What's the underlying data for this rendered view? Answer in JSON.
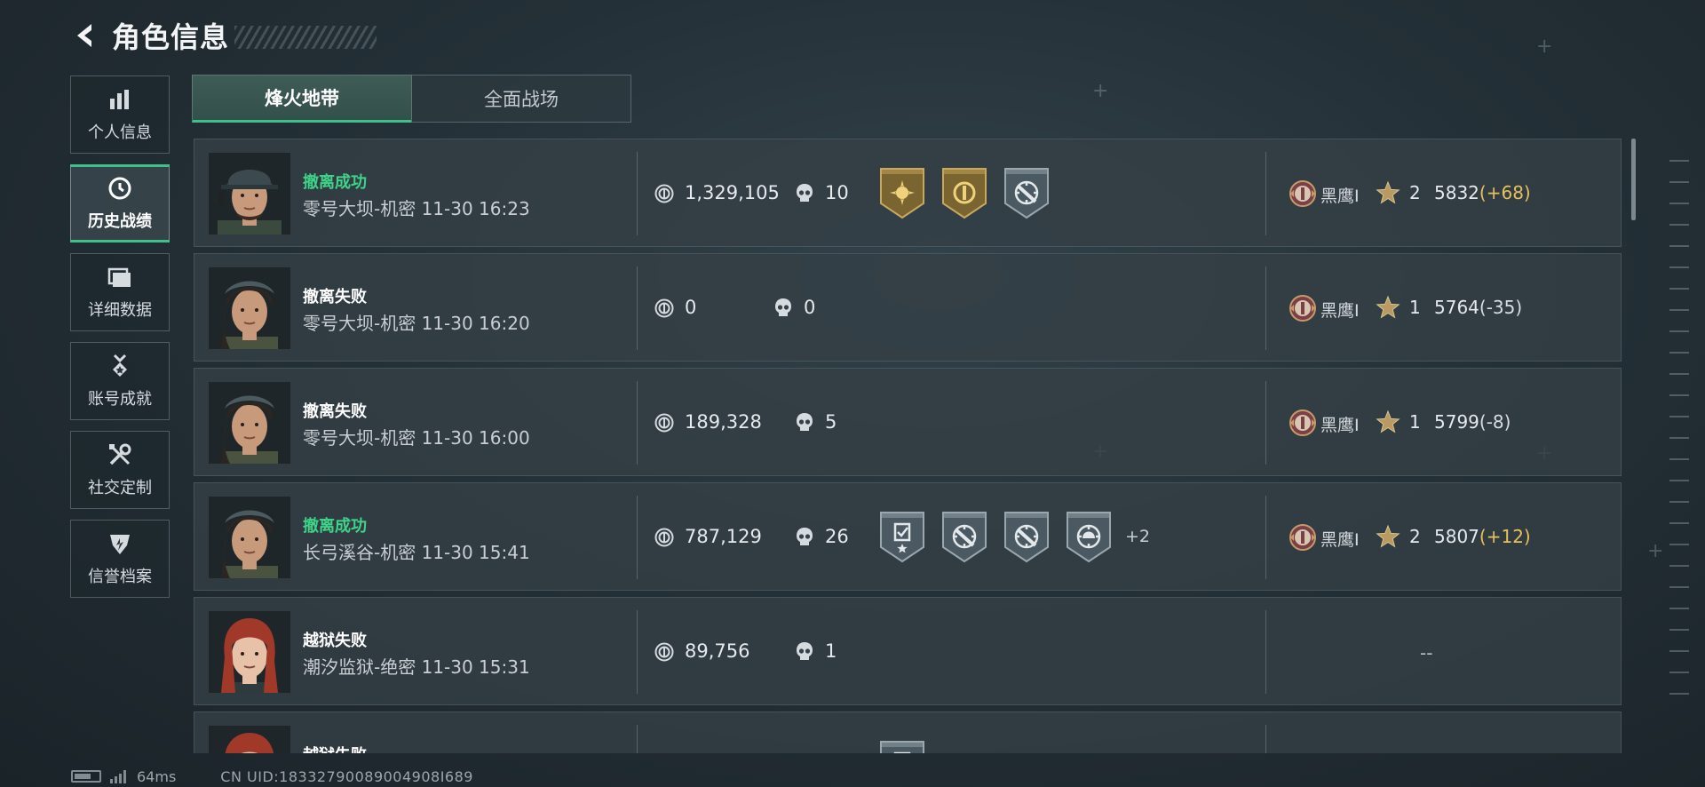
{
  "header": {
    "title": "角色信息"
  },
  "sidebar": {
    "items": [
      {
        "label": "个人信息",
        "icon": "bar-chart-icon",
        "active": false
      },
      {
        "label": "历史战绩",
        "icon": "clock-icon",
        "active": true
      },
      {
        "label": "详细数据",
        "icon": "folder-icon",
        "active": false
      },
      {
        "label": "账号成就",
        "icon": "medal-icon",
        "active": false
      },
      {
        "label": "社交定制",
        "icon": "tools-icon",
        "active": false
      },
      {
        "label": "信誉档案",
        "icon": "shield-emblem-icon",
        "active": false
      }
    ]
  },
  "tabs": [
    {
      "label": "烽火地带",
      "active": true
    },
    {
      "label": "全面战场",
      "active": false
    }
  ],
  "colors": {
    "accent": "#3fc08a",
    "success": "#3fd38a",
    "delta_positive": "#e7c15a"
  },
  "matches": [
    {
      "status": "撤离成功",
      "success": true,
      "detail": "零号大坝-机密 11-30 16:23",
      "money": "1,329,105",
      "kills": "10",
      "badges": [
        "sun-emblem-badge",
        "laurel-emblem-badge",
        "crosshair-badge"
      ],
      "badges_more": "",
      "rank": "黑鹰I",
      "stars": "2",
      "score": "5832",
      "delta": "(+68)",
      "delta_positive": true,
      "avatar": "male-operator-cap"
    },
    {
      "status": "撤离失败",
      "success": false,
      "detail": "零号大坝-机密 11-30 16:20",
      "money": "0",
      "kills": "0",
      "badges": [],
      "badges_more": "",
      "rank": "黑鹰I",
      "stars": "1",
      "score": "5764",
      "delta": "(-35)",
      "delta_positive": false,
      "avatar": "female-operator-bandana"
    },
    {
      "status": "撤离失败",
      "success": false,
      "detail": "零号大坝-机密 11-30 16:00",
      "money": "189,328",
      "kills": "5",
      "badges": [],
      "badges_more": "",
      "rank": "黑鹰I",
      "stars": "1",
      "score": "5799",
      "delta": "(-8)",
      "delta_positive": false,
      "avatar": "female-operator-bandana"
    },
    {
      "status": "撤离成功",
      "success": true,
      "detail": "长弓溪谷-机密 11-30 15:41",
      "money": "787,129",
      "kills": "26",
      "badges": [
        "clipboard-star-badge",
        "crosshair-badge",
        "crosshair-badge",
        "helmet-target-badge"
      ],
      "badges_more": "+2",
      "rank": "黑鹰I",
      "stars": "2",
      "score": "5807",
      "delta": "(+12)",
      "delta_positive": true,
      "avatar": "female-operator-bandana"
    },
    {
      "status": "越狱失败",
      "success": false,
      "detail": "潮汐监狱-绝密 11-30 15:31",
      "money": "89,756",
      "kills": "1",
      "badges": [],
      "badges_more": "",
      "rank": "",
      "stars": "",
      "score": "",
      "delta": "",
      "delta_positive": false,
      "no_rank_text": "--",
      "avatar": "female-operator-redhair"
    },
    {
      "status": "越狱失败",
      "success": false,
      "detail": "",
      "money": "",
      "kills": "",
      "badges": [
        "clipboard-star-badge"
      ],
      "badges_more": "",
      "rank": "",
      "stars": "",
      "score": "",
      "delta": "",
      "delta_positive": false,
      "avatar": "female-operator-redhair"
    }
  ],
  "footer": {
    "ping": "64ms",
    "uid": "CN UID:18332790089004908I689"
  }
}
